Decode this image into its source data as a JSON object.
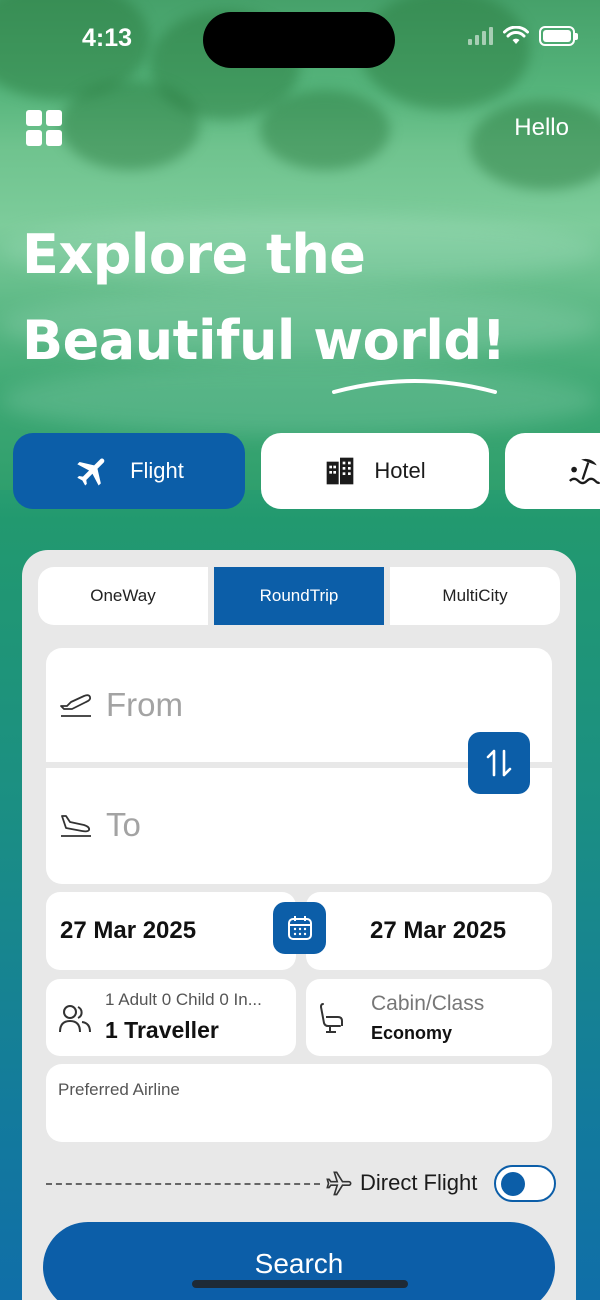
{
  "status_bar": {
    "time": "4:13"
  },
  "header": {
    "greeting": "Hello"
  },
  "hero": {
    "line1": "Explore the",
    "line2": "Beautiful world!"
  },
  "service_tabs": [
    {
      "label": "Flight",
      "icon": "airplane-icon",
      "active": true
    },
    {
      "label": "Hotel",
      "icon": "building-icon",
      "active": false
    },
    {
      "label": "",
      "icon": "beach-umbrella-icon",
      "active": false
    }
  ],
  "trip_types": [
    {
      "label": "OneWay",
      "active": false
    },
    {
      "label": "RoundTrip",
      "active": true
    },
    {
      "label": "MultiCity",
      "active": false
    }
  ],
  "route": {
    "from_placeholder": "From",
    "to_placeholder": "To"
  },
  "dates": {
    "depart": "27 Mar 2025",
    "return": "27 Mar 2025"
  },
  "travellers": {
    "summary": "1 Adult 0 Child 0 In...",
    "count": "1 Traveller"
  },
  "cabin": {
    "label": "Cabin/Class",
    "value": "Economy"
  },
  "preferred_airline": {
    "label": "Preferred Airline"
  },
  "direct_flight": {
    "label": "Direct Flight",
    "enabled": true
  },
  "search_button": {
    "label": "Search"
  },
  "colors": {
    "primary": "#0c5ea8",
    "card": "#e8e8e8",
    "background_green": "#3fae74",
    "background_blue": "#106ea8"
  }
}
